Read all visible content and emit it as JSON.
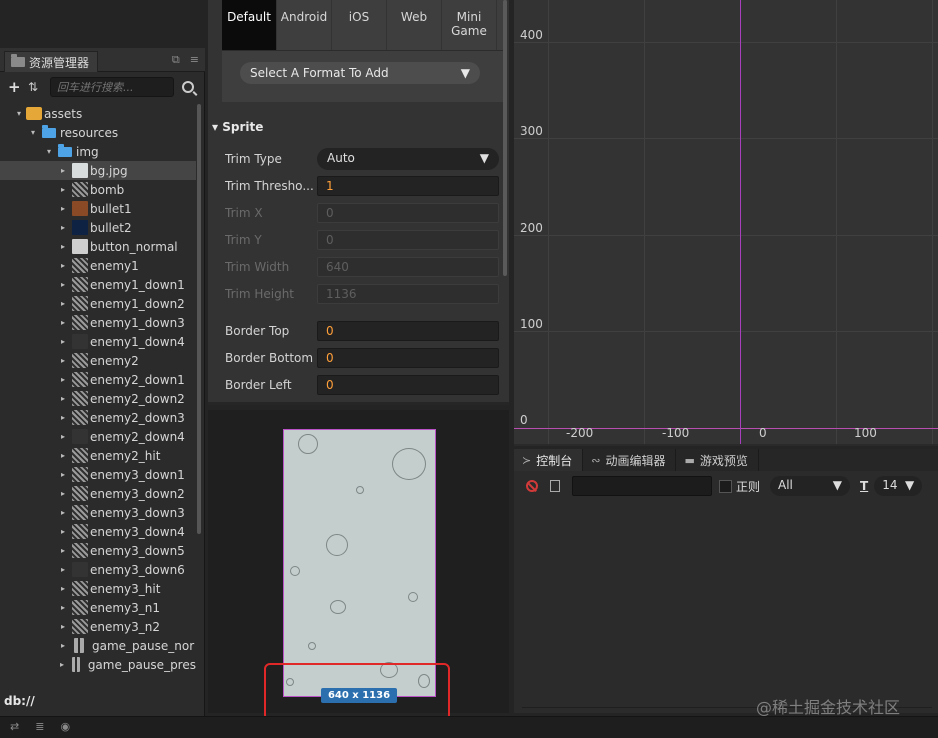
{
  "assets_panel": {
    "title": "资源管理器",
    "search_placeholder": "回车进行搜索...",
    "db_path": "db://",
    "tree": [
      {
        "label": "assets",
        "kind": "assets"
      },
      {
        "label": "resources",
        "kind": "folder"
      },
      {
        "label": "img",
        "kind": "folder"
      },
      {
        "label": "bg.jpg",
        "kind": "image",
        "color": "#d8dcdc",
        "selected": true
      },
      {
        "label": "bomb",
        "kind": "sprite"
      },
      {
        "label": "bullet1",
        "kind": "image",
        "color": "#8a4a25"
      },
      {
        "label": "bullet2",
        "kind": "image",
        "color": "#0e2244"
      },
      {
        "label": "button_normal",
        "kind": "image",
        "color": "#cfcfcf"
      },
      {
        "label": "enemy1",
        "kind": "sprite"
      },
      {
        "label": "enemy1_down1",
        "kind": "sprite"
      },
      {
        "label": "enemy1_down2",
        "kind": "sprite"
      },
      {
        "label": "enemy1_down3",
        "kind": "sprite"
      },
      {
        "label": "enemy1_down4",
        "kind": "dark"
      },
      {
        "label": "enemy2",
        "kind": "sprite"
      },
      {
        "label": "enemy2_down1",
        "kind": "sprite"
      },
      {
        "label": "enemy2_down2",
        "kind": "sprite"
      },
      {
        "label": "enemy2_down3",
        "kind": "sprite"
      },
      {
        "label": "enemy2_down4",
        "kind": "dark"
      },
      {
        "label": "enemy2_hit",
        "kind": "sprite"
      },
      {
        "label": "enemy3_down1",
        "kind": "sprite"
      },
      {
        "label": "enemy3_down2",
        "kind": "sprite"
      },
      {
        "label": "enemy3_down3",
        "kind": "sprite"
      },
      {
        "label": "enemy3_down4",
        "kind": "sprite"
      },
      {
        "label": "enemy3_down5",
        "kind": "sprite"
      },
      {
        "label": "enemy3_down6",
        "kind": "dark"
      },
      {
        "label": "enemy3_hit",
        "kind": "sprite"
      },
      {
        "label": "enemy3_n1",
        "kind": "sprite"
      },
      {
        "label": "enemy3_n2",
        "kind": "sprite"
      },
      {
        "label": "game_pause_nor",
        "kind": "bar"
      },
      {
        "label": "game_pause_pres",
        "kind": "bar"
      }
    ]
  },
  "inspector": {
    "platform_tabs": [
      {
        "label": "Default",
        "active": true
      },
      {
        "label": "Android"
      },
      {
        "label": "iOS"
      },
      {
        "label": "Web"
      },
      {
        "label": "Mini\nGame"
      }
    ],
    "format_select": "Select A Format To Add",
    "section_title": "Sprite",
    "trim_type": {
      "label": "Trim Type",
      "value": "Auto"
    },
    "trim_threshold": {
      "label": "Trim Thresho...",
      "value": "1"
    },
    "trim_x": {
      "label": "Trim X",
      "value": "0"
    },
    "trim_y": {
      "label": "Trim Y",
      "value": "0"
    },
    "trim_width": {
      "label": "Trim Width",
      "value": "640"
    },
    "trim_height": {
      "label": "Trim Height",
      "value": "1136"
    },
    "border_top": {
      "label": "Border Top",
      "value": "0"
    },
    "border_bottom": {
      "label": "Border Bottom",
      "value": "0"
    },
    "border_left": {
      "label": "Border Left",
      "value": "0"
    }
  },
  "preview": {
    "size_label": "640 x 1136"
  },
  "scene": {
    "y_labels": [
      "400",
      "300",
      "200",
      "100",
      "0"
    ],
    "x_labels": [
      "-200",
      "-100",
      "0",
      "100"
    ],
    "axis_color": "#b84fb0"
  },
  "console": {
    "tabs": [
      {
        "label": "控制台",
        "active": true,
        "icon": "terminal-icon",
        "glyph": "≻"
      },
      {
        "label": "动画编辑器",
        "icon": "animation-icon",
        "glyph": "∾"
      },
      {
        "label": "游戏预览",
        "icon": "camera-icon",
        "glyph": "▬"
      }
    ],
    "regex_label": "正则",
    "level": "All",
    "font_size": "14"
  },
  "watermark": "@稀土掘金技术社区"
}
